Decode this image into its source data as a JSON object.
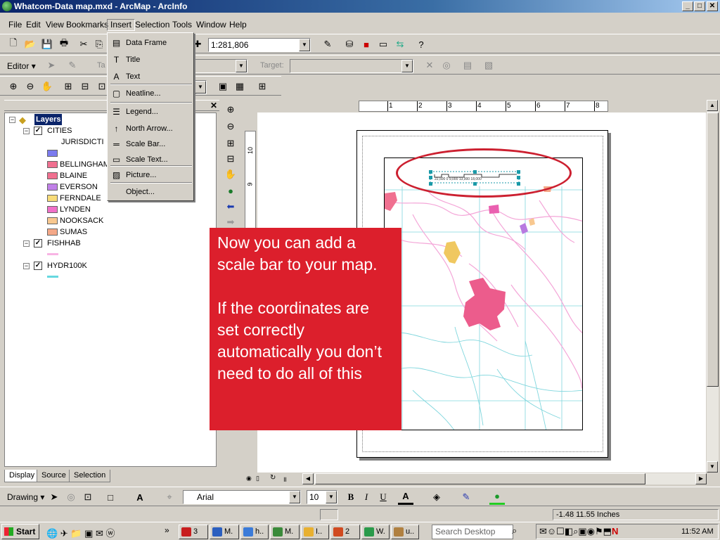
{
  "window": {
    "title": "Whatcom-Data map.mxd - ArcMap - ArcInfo",
    "min": "_",
    "max": "□",
    "close": "✕"
  },
  "menubar": [
    "File",
    "Edit",
    "View",
    "Bookmarks",
    "Insert",
    "Selection",
    "Tools",
    "Window",
    "Help"
  ],
  "toolbar": {
    "scale_value": "1:281,806",
    "editor_label": "Editor",
    "task_label": "Ta",
    "target_label": "Target:"
  },
  "insert_menu": [
    {
      "label": "Data Frame",
      "icon": "data-frame-icon"
    },
    {
      "label": "Title",
      "icon": "title-icon"
    },
    {
      "label": "Text",
      "icon": "text-icon"
    },
    {
      "label": "Neatline...",
      "icon": "neatline-icon"
    },
    {
      "label": "Legend...",
      "icon": "legend-icon"
    },
    {
      "label": "North Arrow...",
      "icon": "north-arrow-icon"
    },
    {
      "label": "Scale Bar...",
      "icon": "scale-bar-icon"
    },
    {
      "label": "Scale Text...",
      "icon": "scale-text-icon"
    },
    {
      "label": "Picture...",
      "icon": "picture-icon"
    },
    {
      "label": "Object...",
      "icon": ""
    }
  ],
  "toc": {
    "root": "Layers",
    "cities": {
      "name": "CITIES",
      "field": "JURISDICTI",
      "items": [
        {
          "label": "",
          "color": "#7b7bef"
        },
        {
          "label": "BELLINGHAM",
          "color": "#f07090"
        },
        {
          "label": "BLAINE",
          "color": "#f07090"
        },
        {
          "label": "EVERSON",
          "color": "#c080e8"
        },
        {
          "label": "FERNDALE",
          "color": "#f8dc78"
        },
        {
          "label": "LYNDEN",
          "color": "#f070c8"
        },
        {
          "label": "NOOKSACK",
          "color": "#f8c890"
        },
        {
          "label": "SUMAS",
          "color": "#f4a888"
        }
      ]
    },
    "fishhab": {
      "name": "FISHHAB",
      "color": "#f8b4e4"
    },
    "hydro": {
      "name": "HYDR100K",
      "color": "#66d8e0"
    }
  },
  "tabs": [
    "Display",
    "Source",
    "Selection"
  ],
  "ruler": [
    "1",
    "2",
    "3",
    "4",
    "5",
    "6",
    "7",
    "8"
  ],
  "vruler": [
    "10",
    "9"
  ],
  "scalebar": {
    "labels": "22,500 0 9,000 13,000 18,000"
  },
  "callout": {
    "p1": "Now you can add a scale bar to your map.",
    "p2": "If the coordinates are set correctly automatically you don’t need to do all of this"
  },
  "drawing": {
    "label": "Drawing",
    "font": "Arial",
    "size": "10",
    "bold": "B",
    "italic": "I",
    "underline": "U"
  },
  "status": {
    "coords": "-1.48  11.55 Inches"
  },
  "taskbar": {
    "start": "Start",
    "tasks": [
      {
        "label": "3",
        "color": "#c81e1e"
      },
      {
        "label": "M.",
        "color": "#2b5fbf"
      },
      {
        "label": "h..",
        "color": "#3b7bd8"
      },
      {
        "label": "M.",
        "color": "#3a8a3a"
      },
      {
        "label": "I..",
        "color": "#e8b030"
      },
      {
        "label": "2",
        "color": "#d04a20"
      },
      {
        "label": "W.",
        "color": "#2a9a4a"
      },
      {
        "label": "u..",
        "color": "#b08040"
      }
    ],
    "search_placeholder": "Search Desktop",
    "clock": "11:52 AM"
  },
  "colors": {
    "accent": "#0a246a",
    "callout": "#dc1f2c",
    "ellipse": "#cc2030"
  }
}
